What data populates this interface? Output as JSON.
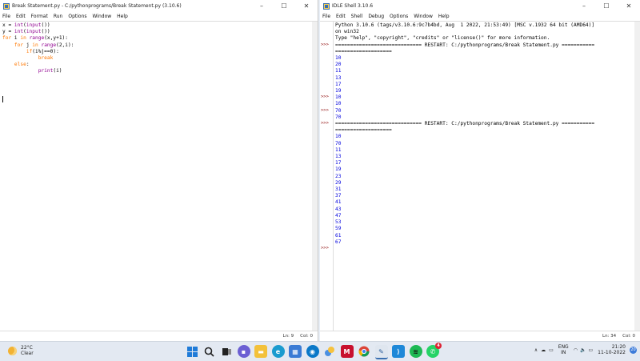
{
  "editor": {
    "title": "Break Statement.py - C:/pythonprograms/Break Statement.py (3.10.6)",
    "menu": [
      "File",
      "Edit",
      "Format",
      "Run",
      "Options",
      "Window",
      "Help"
    ],
    "code_lines": [
      "x = int(input())",
      "y = int(input())",
      "for i in range(x,y+1):",
      "    for j in range(2,i):",
      "        if(i%j==0):",
      "            break",
      "    else:",
      "            print(i)"
    ],
    "status_ln": "Ln: 9",
    "status_col": "Col: 0"
  },
  "shell": {
    "title": "IDLE Shell 3.10.6",
    "menu": [
      "File",
      "Edit",
      "Shell",
      "Debug",
      "Options",
      "Window",
      "Help"
    ],
    "banner": [
      "Python 3.10.6 (tags/v3.10.6:9c7b4bd, Aug  1 2022, 21:53:49) [MSC v.1932 64 bit (AMD64)]",
      "on win32",
      "Type \"help\", \"copyright\", \"credits\" or \"license()\" for more information."
    ],
    "restart1": "============================= RESTART: C:/pythonprograms/Break Statement.py ===========",
    "restart1_cont": "===================",
    "run1_output": [
      "10",
      "20",
      "11",
      "13",
      "17",
      "19"
    ],
    "run2_output": [
      "10",
      "10"
    ],
    "run3_output": [
      "70",
      "70"
    ],
    "restart2": "============================= RESTART: C:/pythonprograms/Break Statement.py ===========",
    "restart2_cont": "===================",
    "run4_output": [
      "10",
      "70",
      "11",
      "13",
      "17",
      "19",
      "23",
      "29",
      "31",
      "37",
      "41",
      "43",
      "47",
      "53",
      "59",
      "61",
      "67"
    ],
    "prompt": ">>>",
    "status_ln": "Ln: 34",
    "status_col": "Col: 0"
  },
  "taskbar": {
    "temperature": "22°C",
    "condition": "Clear",
    "lang_top": "ENG",
    "lang_bottom": "IN",
    "time": "21:20",
    "date": "11-10-2022",
    "notification_count": "20",
    "whatsapp_badge": "4"
  }
}
